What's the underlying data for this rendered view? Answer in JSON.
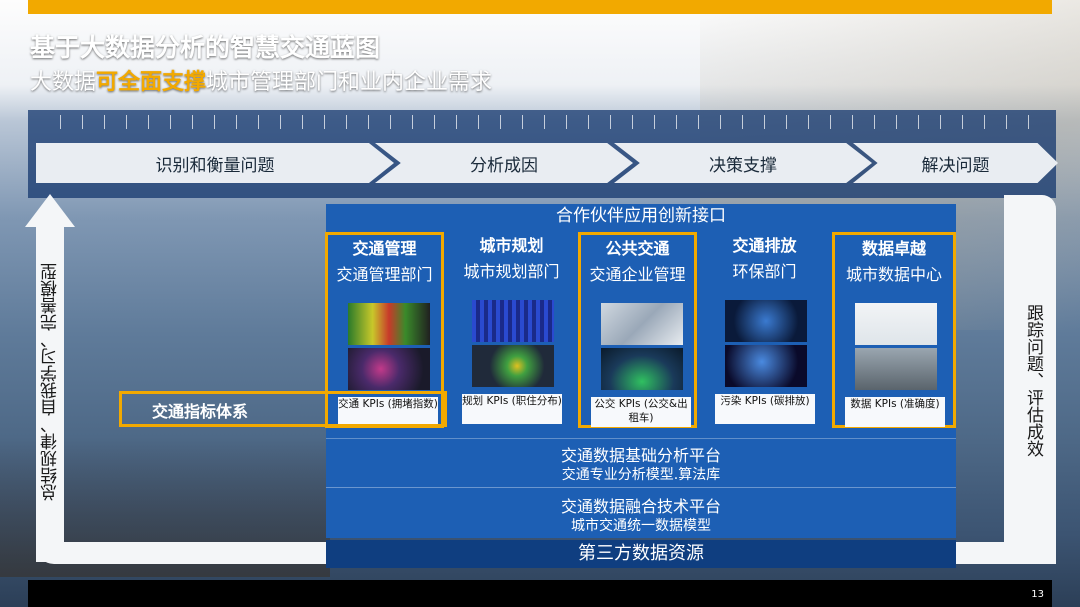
{
  "title": "基于大数据分析的智慧交通蓝图",
  "subtitle": {
    "pre": "大数据",
    "highlight": "可全面支撑",
    "post": "城市管理部门和业内企业需求"
  },
  "flow_steps": [
    "识别和衡量问题",
    "分析成因",
    "决策支撑",
    "解决问题"
  ],
  "left_loop_text": "总结规律、自我学习、完善模型",
  "right_loop_text": "跟踪问题、评估成效",
  "partner_interface": "合作伙伴应用创新接口",
  "metric_system_label": "交通指标体系",
  "columns": [
    {
      "heading": "交通管理",
      "dept": "交通管理部门",
      "kpi": "交通 KPIs (拥堵指数)"
    },
    {
      "heading": "城市规划",
      "dept": "城市规划部门",
      "kpi": "规划 KPIs (职住分布)"
    },
    {
      "heading": "公共交通",
      "dept": "交通企业管理",
      "kpi": "公交 KPIs (公交&出租车)"
    },
    {
      "heading": "交通排放",
      "dept": "环保部门",
      "kpi": "污染 KPIs (碳排放)"
    },
    {
      "heading": "数据卓越",
      "dept": "城市数据中心",
      "kpi": "数据 KPIs (准确度)"
    }
  ],
  "platform_analysis": {
    "title": "交通数据基础分析平台",
    "sub": "交通专业分析模型.算法库"
  },
  "platform_fusion": {
    "title": "交通数据融合技术平台",
    "sub": "城市交通统一数据模型"
  },
  "third_party": "第三方数据资源",
  "page_number": "13",
  "colors": {
    "accent": "#f2a900",
    "panel": "#1d5fb4",
    "dark_panel": "#0f3e80"
  }
}
